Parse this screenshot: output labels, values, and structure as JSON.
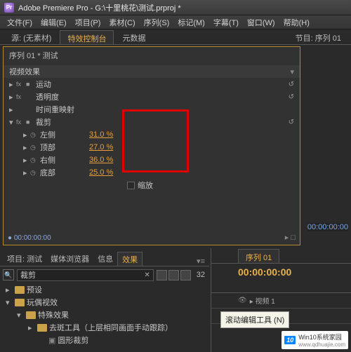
{
  "titlebar": {
    "title": "Adobe Premiere Pro - G:\\十里桃花\\测试.prproj *"
  },
  "menubar": {
    "items": [
      "文件(F)",
      "编辑(E)",
      "项目(P)",
      "素材(C)",
      "序列(S)",
      "标记(M)",
      "字幕(T)",
      "窗口(W)",
      "帮助(H)"
    ]
  },
  "left_tabs": {
    "items": [
      "源: (无素材)",
      "特效控制台",
      "元数据"
    ],
    "active": 1
  },
  "right_tabs": {
    "items": [
      "节目: 序列 01"
    ]
  },
  "effect_panel": {
    "heading": "序列 01 * 测试",
    "video_effects": "视频效果",
    "rows": [
      {
        "kind": "fx",
        "name": "运动",
        "link": true,
        "back": true
      },
      {
        "kind": "fx",
        "name": "透明度",
        "link": false,
        "back": true
      },
      {
        "kind": "plain",
        "name": "时间重映射"
      },
      {
        "kind": "fx",
        "name": "裁剪",
        "link": true,
        "back": true,
        "expanded": true
      }
    ],
    "crop": [
      {
        "label": "左侧",
        "value": "31.0 %"
      },
      {
        "label": "顶部",
        "value": "27.0 %"
      },
      {
        "label": "右侧",
        "value": "36.0 %"
      },
      {
        "label": "底部",
        "value": "25.0 %"
      }
    ],
    "scale_label": "缩放",
    "footer_time": "00:00:00:00"
  },
  "bottom_tabs": {
    "items": [
      "项目: 测试",
      "媒体浏览器",
      "信息",
      "效果"
    ],
    "active": 3
  },
  "search": {
    "value": "裁剪",
    "count": "32"
  },
  "tree": {
    "nodes": [
      {
        "depth": 0,
        "tw": "▸",
        "name": "预设"
      },
      {
        "depth": 0,
        "tw": "▾",
        "name": "玩偶视效"
      },
      {
        "depth": 1,
        "tw": "▾",
        "name": "特殊效果"
      },
      {
        "depth": 2,
        "tw": "▸",
        "name": "去斑工具（上层相同画面手动跟踪）"
      },
      {
        "depth": 3,
        "tw": "",
        "name": "圆形裁剪"
      }
    ]
  },
  "timeline": {
    "seq_tab": "序列 01",
    "timecode": "00:00:00:00",
    "track_label": "视频 1"
  },
  "tooltip": "滚动编辑工具 (N)",
  "right_area_time": "00:00:00:00",
  "watermark": {
    "badge": "10",
    "text": "Win10系统家园",
    "url": "www.qdhuajie.com"
  }
}
